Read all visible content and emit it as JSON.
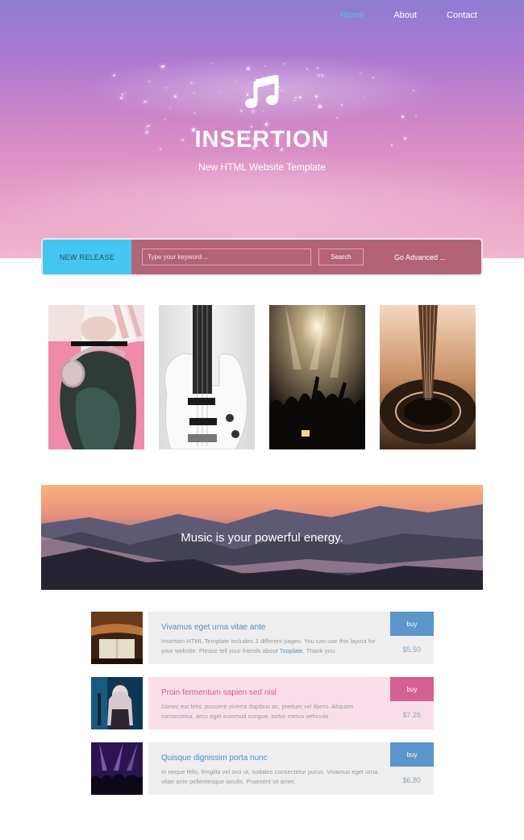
{
  "nav": {
    "items": [
      {
        "label": "Home",
        "active": true
      },
      {
        "label": "About",
        "active": false
      },
      {
        "label": "Contact",
        "active": false
      }
    ]
  },
  "hero": {
    "icon": "music-note-icon",
    "title": "INSERTION",
    "subtitle": "New HTML Website Template"
  },
  "search": {
    "tag": "NEW RELEASE",
    "placeholder": "Type your keyword ...",
    "button": "Search",
    "advanced": "Go Advanced ..."
  },
  "gallery": [
    {
      "subject": "woman-with-headphones"
    },
    {
      "subject": "white-electric-guitar"
    },
    {
      "subject": "concert-crowd"
    },
    {
      "subject": "acoustic-guitar-closeup"
    }
  ],
  "banner": {
    "text": "Music is your powerful energy."
  },
  "items": [
    {
      "title": "Vivamus eget urna vitae ante",
      "desc": "Insertion HTML Template includes 3 different pages. You can use this layout for your website. Please tell your friends about",
      "link": "Tooplate",
      "desc_end": ". Thank you.",
      "buy": "buy",
      "price": "$5.50",
      "title_color": "#4a90c8",
      "bg": "#eeeeef",
      "buy_color": "#5b95c9"
    },
    {
      "title": "Proin fermentum sapien sed nisl",
      "desc": "Donec est felis, posuere viverra dapibus ac, pretium vel libero. Aliquam consectetur, arcu eget euismod congue, tortor metus vehicula",
      "link": "",
      "desc_end": "",
      "buy": "buy",
      "price": "$7.25",
      "title_color": "#d0588a",
      "bg": "#fadfea",
      "buy_color": "#d46191"
    },
    {
      "title": "Quisque dignissim porta nunc",
      "desc": "In neque felis, fringilla vel orci ut, sodales consectetur purus. Vivamus eget urna vitae ante pellentesque iaculis. Praesent sit amet.",
      "link": "",
      "desc_end": "",
      "buy": "buy",
      "price": "$6.80",
      "title_color": "#4a90c8",
      "bg": "#eeeeef",
      "buy_color": "#5b95c9"
    }
  ]
}
